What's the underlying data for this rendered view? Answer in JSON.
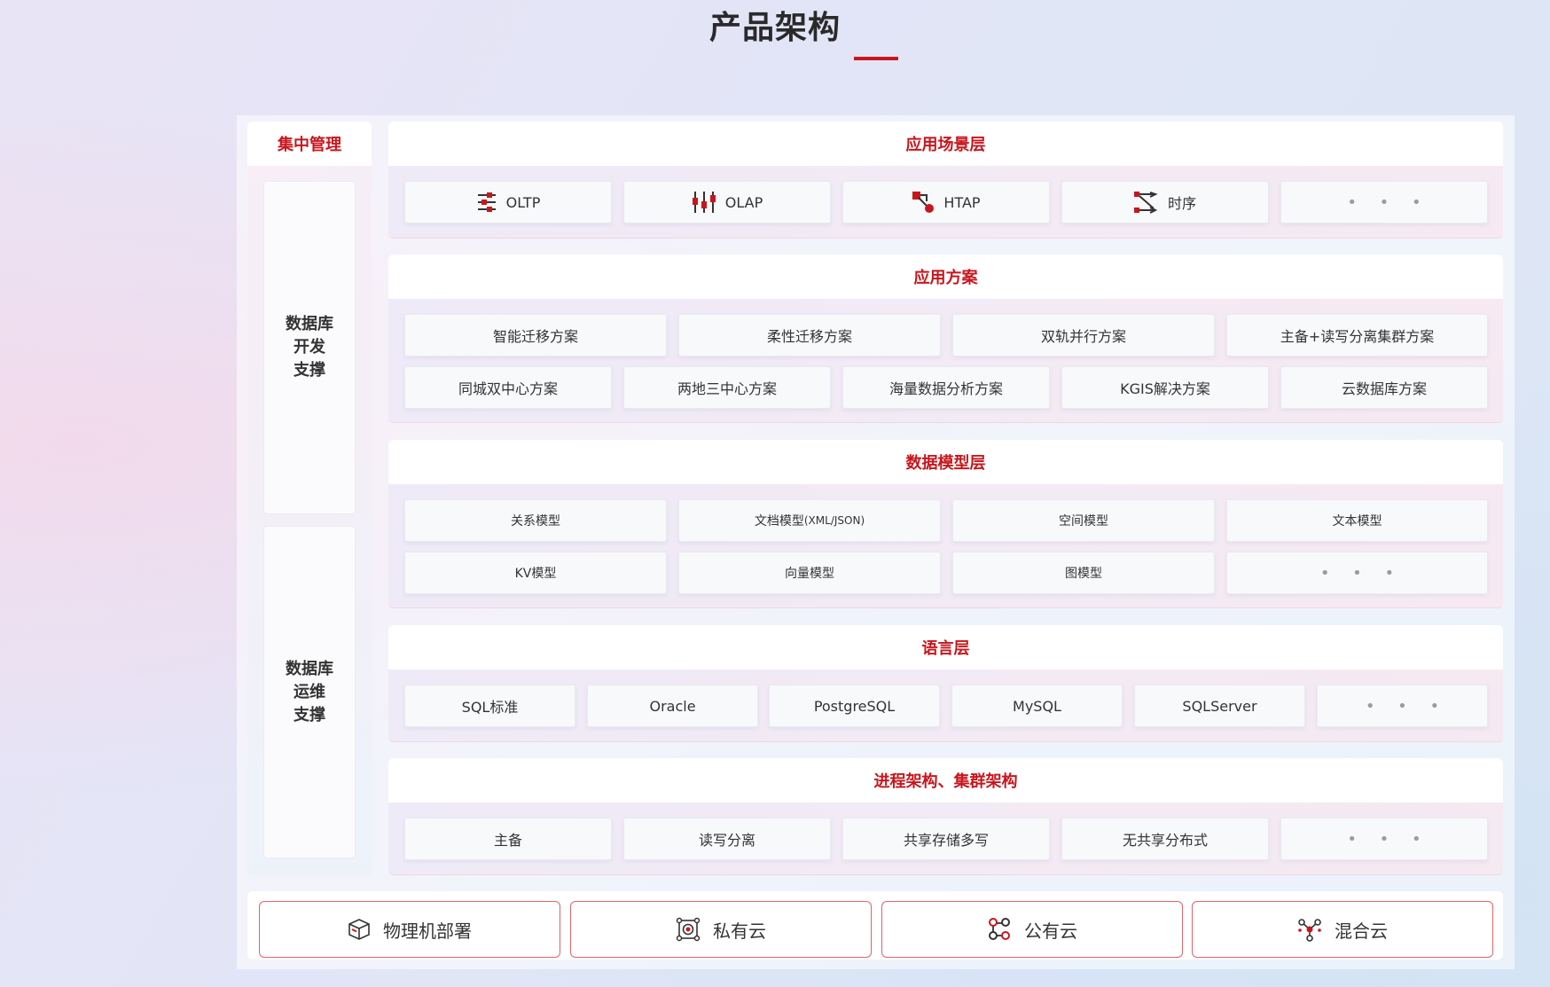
{
  "page": {
    "title": "产品架构"
  },
  "left": {
    "header": "集中管理",
    "dev_support": "数据库\n开发\n支撑",
    "ops_support": "数据库\n运维\n支撑"
  },
  "sections": [
    {
      "title": "应用场景层",
      "items": [
        {
          "label": "OLTP",
          "icon": "sliders-icon"
        },
        {
          "label": "OLAP",
          "icon": "candlestick-icon"
        },
        {
          "label": "HTAP",
          "icon": "nodes-icon"
        },
        {
          "label": "时序",
          "icon": "flow-icon"
        },
        {
          "label": "• • •"
        }
      ]
    },
    {
      "title": "应用方案",
      "items": [
        "智能迁移方案",
        "柔性迁移方案",
        "双轨并行方案",
        "主备+读写分离集群方案",
        "同城双中心方案",
        "两地三中心方案",
        "海量数据分析方案",
        "KGIS解决方案",
        "云数据库方案"
      ]
    },
    {
      "title": "数据模型层",
      "items": [
        "关系模型",
        "文档模型",
        "空间模型",
        "文本模型",
        "KV模型",
        "向量模型",
        "图模型",
        "• • •"
      ],
      "doc_suffix": "(XML/JSON)"
    },
    {
      "title": "语言层",
      "items": [
        "SQL标准",
        "Oracle",
        "PostgreSQL",
        "MySQL",
        "SQLServer",
        "• • •"
      ]
    },
    {
      "title": "进程架构、集群架构",
      "items": [
        "主备",
        "读写分离",
        "共享存储多写",
        "无共享分布式",
        "• • •"
      ]
    }
  ],
  "deployment": [
    {
      "label": "物理机部署",
      "icon": "cube-icon"
    },
    {
      "label": "私有云",
      "icon": "private-cloud-icon"
    },
    {
      "label": "公有云",
      "icon": "public-cloud-icon"
    },
    {
      "label": "混合云",
      "icon": "hybrid-cloud-icon"
    }
  ],
  "colors": {
    "accent": "#c8161d",
    "text": "#333333"
  }
}
